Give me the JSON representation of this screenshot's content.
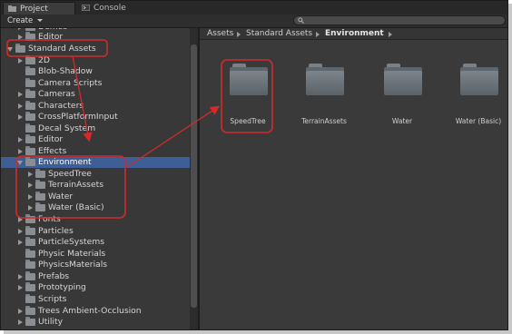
{
  "tabs": [
    {
      "label": "Project",
      "icon": "project-icon",
      "active": true
    },
    {
      "label": "Console",
      "icon": "console-icon",
      "active": false
    }
  ],
  "toolbar": {
    "create_label": "Create",
    "search_value": ""
  },
  "tree": [
    {
      "label": "Demos",
      "depth": 1,
      "expand": "r"
    },
    {
      "label": "Editor",
      "depth": 1,
      "expand": "r"
    },
    {
      "label": "Standard Assets",
      "depth": 0,
      "expand": "d"
    },
    {
      "label": "2D",
      "depth": 1,
      "expand": "r"
    },
    {
      "label": "Blob-Shadow",
      "depth": 1,
      "expand": ""
    },
    {
      "label": "Camera Scripts",
      "depth": 1,
      "expand": ""
    },
    {
      "label": "Cameras",
      "depth": 1,
      "expand": "r"
    },
    {
      "label": "Characters",
      "depth": 1,
      "expand": "r"
    },
    {
      "label": "CrossPlatformInput",
      "depth": 1,
      "expand": "r"
    },
    {
      "label": "Decal System",
      "depth": 1,
      "expand": ""
    },
    {
      "label": "Editor",
      "depth": 1,
      "expand": "r"
    },
    {
      "label": "Effects",
      "depth": 1,
      "expand": "r"
    },
    {
      "label": "Environment",
      "depth": 1,
      "expand": "d",
      "selected": true
    },
    {
      "label": "SpeedTree",
      "depth": 2,
      "expand": "r"
    },
    {
      "label": "TerrainAssets",
      "depth": 2,
      "expand": "r"
    },
    {
      "label": "Water",
      "depth": 2,
      "expand": "r"
    },
    {
      "label": "Water (Basic)",
      "depth": 2,
      "expand": "r"
    },
    {
      "label": "Fonts",
      "depth": 1,
      "expand": "r"
    },
    {
      "label": "Particles",
      "depth": 1,
      "expand": "r"
    },
    {
      "label": "ParticleSystems",
      "depth": 1,
      "expand": "r"
    },
    {
      "label": "Physic Materials",
      "depth": 1,
      "expand": ""
    },
    {
      "label": "PhysicsMaterials",
      "depth": 1,
      "expand": ""
    },
    {
      "label": "Prefabs",
      "depth": 1,
      "expand": "r"
    },
    {
      "label": "Prototyping",
      "depth": 1,
      "expand": "r"
    },
    {
      "label": "Scripts",
      "depth": 1,
      "expand": ""
    },
    {
      "label": "Trees Ambient-Occlusion",
      "depth": 1,
      "expand": "r"
    },
    {
      "label": "Utility",
      "depth": 1,
      "expand": "r"
    }
  ],
  "breadcrumb": [
    "Assets",
    "Standard Assets",
    "Environment"
  ],
  "folders": [
    {
      "label": "SpeedTree"
    },
    {
      "label": "TerrainAssets"
    },
    {
      "label": "Water"
    },
    {
      "label": "Water (Basic)"
    }
  ],
  "annotation_color": "#d42a2a",
  "selection_color": "#3d5f96"
}
